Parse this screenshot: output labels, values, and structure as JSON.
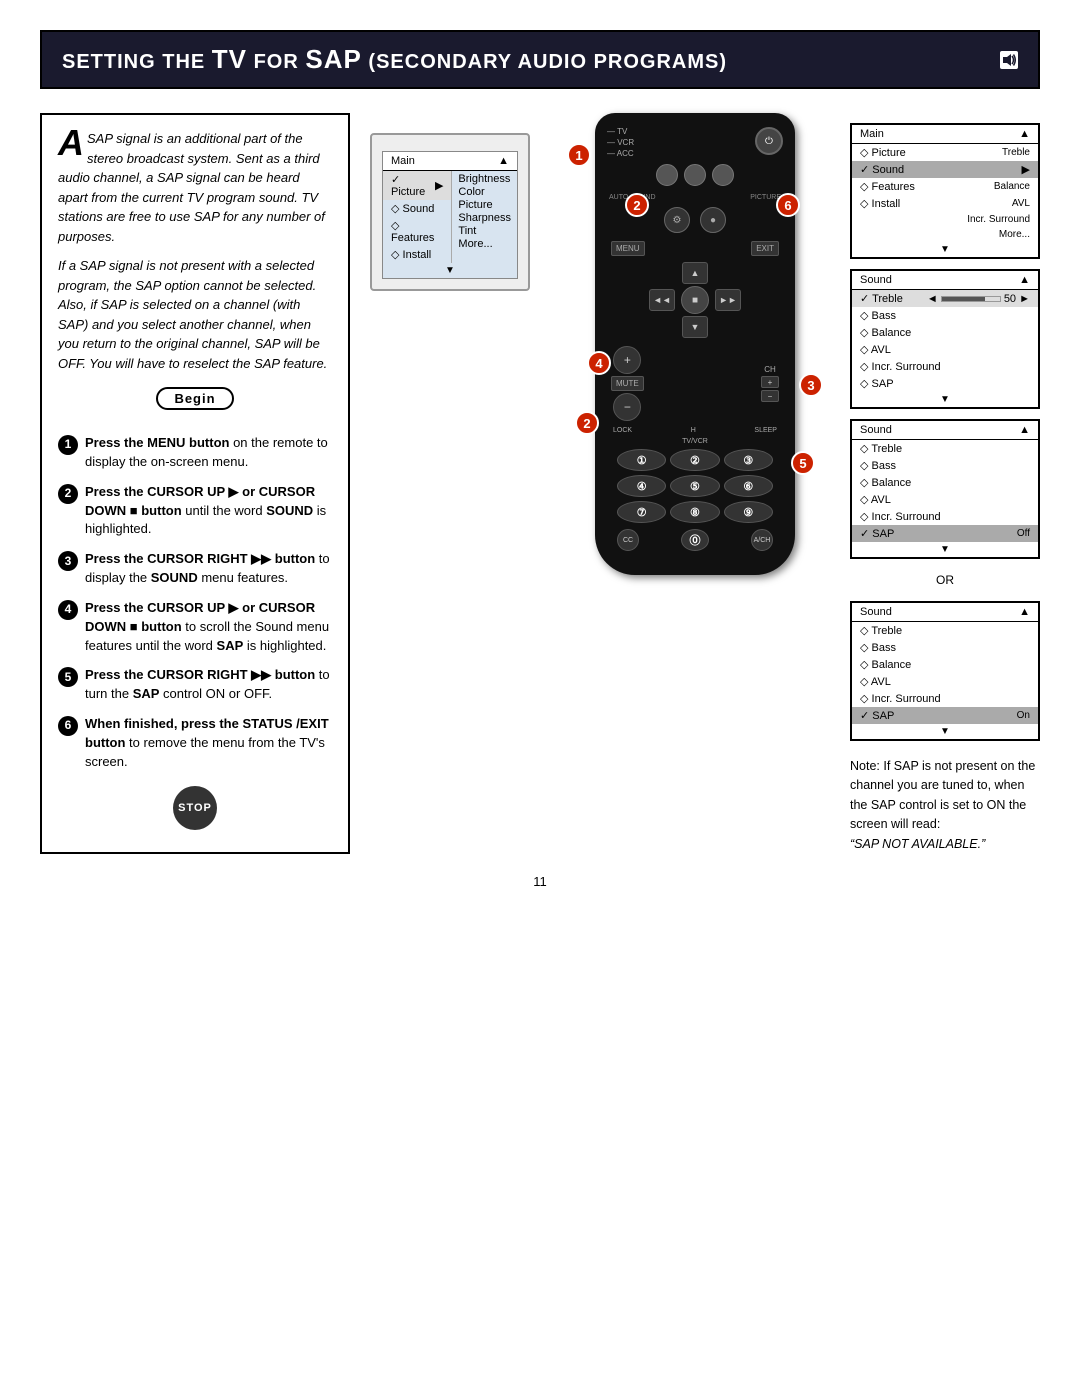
{
  "title": {
    "prefix": "Setting the",
    "tv": "TV",
    "middle": "for",
    "sap": "SAP",
    "suffix": "(Secondary Audio Programs)"
  },
  "intro": {
    "drop_cap": "A",
    "para1": "SAP signal is an additional part of the stereo broadcast system. Sent as a third audio channel, a SAP signal can be heard apart from the current TV program sound. TV stations are free to use SAP for any number of purposes.",
    "para2": "If a SAP signal is not present with a selected program, the SAP option cannot be selected. Also, if SAP is selected on a channel (with SAP) and you select another channel, when you return to the original channel, SAP will be OFF. You will have to reselect the SAP feature."
  },
  "begin_label": "Begin",
  "steps": [
    {
      "num": "1",
      "text": "Press the MENU button on the remote to display the on-screen menu."
    },
    {
      "num": "2",
      "text": "Press the CURSOR UP ▶ or CURSOR DOWN ■ button until the word SOUND is highlighted."
    },
    {
      "num": "3",
      "text": "Press the CURSOR RIGHT ▶▶ button to display the SOUND menu features."
    },
    {
      "num": "4",
      "text": "Press the CURSOR UP ▶ or CURSOR DOWN ■ button to scroll the Sound menu features until the word SAP is highlighted."
    },
    {
      "num": "5",
      "text": "Press the CURSOR RIGHT ▶▶ button to turn the SAP control ON or OFF."
    },
    {
      "num": "6",
      "text": "When finished, press the STATUS /EXIT button to remove the menu from the TV's screen."
    }
  ],
  "left_menu": {
    "header": "Main",
    "items": [
      {
        "label": "✓ Picture",
        "arrow": "▶",
        "submenu": [
          "Brightness",
          "Color",
          "Picture",
          "Sharpness",
          "Tint",
          "More..."
        ]
      },
      {
        "label": "◇ Sound"
      },
      {
        "label": "◇ Features"
      },
      {
        "label": "◇ Install"
      }
    ],
    "footer": "▼"
  },
  "right_menu1": {
    "header": "Main",
    "items": [
      {
        "label": "◇ Picture",
        "value": "Treble"
      },
      {
        "label": "✓ Sound",
        "arrow": "▶",
        "highlighted": true
      },
      {
        "label": "◇ Features",
        "value": "Balance"
      },
      {
        "label": "◇ Install",
        "value": "AVL"
      },
      {
        "label": "",
        "value": "Incr. Surround"
      },
      {
        "label": "",
        "value": "More..."
      }
    ],
    "footer": "▼"
  },
  "right_menu2": {
    "header": "Sound",
    "items": [
      {
        "label": "✓ Treble",
        "progress": 50,
        "arrow_left": "◄",
        "arrow_right": "►"
      },
      {
        "label": "◇ Bass"
      },
      {
        "label": "◇ Balance"
      },
      {
        "label": "◇ AVL"
      },
      {
        "label": "◇ Incr. Surround"
      },
      {
        "label": "◇ SAP"
      }
    ],
    "footer": "▼"
  },
  "right_menu3": {
    "header": "Sound",
    "items": [
      {
        "label": "◇ Treble"
      },
      {
        "label": "◇ Bass"
      },
      {
        "label": "◇ Balance"
      },
      {
        "label": "◇ AVL"
      },
      {
        "label": "◇ Incr. Surround"
      },
      {
        "label": "✓ SAP",
        "value": "Off",
        "highlighted": true
      }
    ],
    "footer": "▼"
  },
  "or_label": "OR",
  "right_menu4": {
    "header": "Sound",
    "items": [
      {
        "label": "◇ Treble"
      },
      {
        "label": "◇ Bass"
      },
      {
        "label": "◇ Balance"
      },
      {
        "label": "◇ AVL"
      },
      {
        "label": "◇ Incr. Surround"
      },
      {
        "label": "✓ SAP",
        "value": "On",
        "highlighted": true
      }
    ],
    "footer": "▼"
  },
  "note": {
    "text": "Note: If SAP is not present on the channel you are tuned to, when the SAP control is set to ON the screen will read:",
    "quoted": "“SAP NOT AVAILABLE.”"
  },
  "page_number": "11",
  "remote": {
    "labels": [
      "TV",
      "VCR",
      "ACC"
    ],
    "power": "⏻",
    "buttons": {
      "menu": "MENU",
      "exit": "EXIT",
      "mute": "MUTE",
      "ch": "CH",
      "tv_vcr": "TV/VCR",
      "lock": "LOCK",
      "h": "H",
      "sleep": "SLEEP"
    },
    "numbers": [
      "1",
      "2",
      "3",
      "4",
      "5",
      "6",
      "7",
      "8",
      "9",
      "0"
    ],
    "special": [
      "CC",
      "0",
      "A/CH"
    ]
  }
}
